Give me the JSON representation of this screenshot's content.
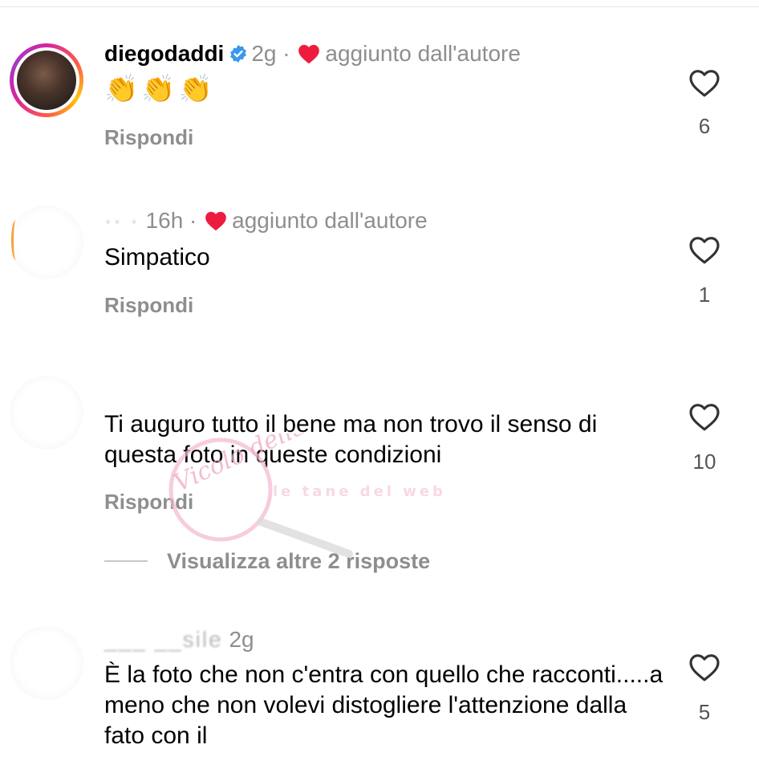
{
  "comments": [
    {
      "username": "diegodaddi",
      "verified": true,
      "time": "2g",
      "liked_by_author": "aggiunto dall'autore",
      "text": "👏👏👏",
      "reply": "Rispondi",
      "likes": "6"
    },
    {
      "username": "·· ·",
      "time": "16h",
      "liked_by_author": "aggiunto dall'autore",
      "text": "Simpatico",
      "reply": "Rispondi",
      "likes": "1"
    },
    {
      "username": "",
      "time": "",
      "text": "Ti auguro tutto il bene ma non trovo il senso di questa foto in queste condizioni",
      "reply": "Rispondi",
      "likes": "10",
      "view_replies": "Visualizza altre 2 risposte"
    },
    {
      "username": "___ __sile",
      "time": "2g",
      "text": "È la foto che non c'entra con quello che racconti.....a meno che non volevi distogliere l'attenzione  dalla fato con il",
      "likes": "5"
    }
  ],
  "watermark": {
    "text": "Vicolo della News",
    "subtext": "le tane del web"
  },
  "colors": {
    "accent_heart": "#ed1c3f",
    "verified": "#3897f0",
    "muted": "#8e8e8e"
  }
}
